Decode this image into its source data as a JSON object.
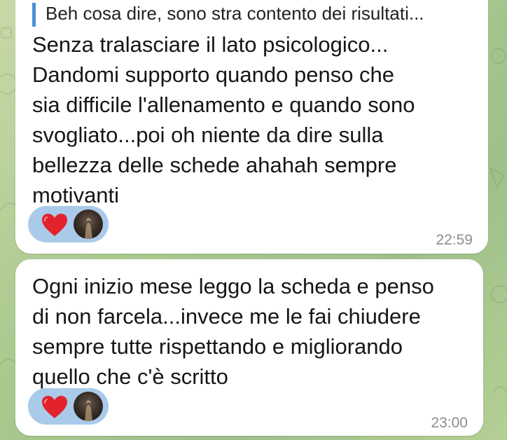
{
  "messages": [
    {
      "reply_preview": "Beh cosa dire, sono stra contento dei risultati...",
      "text": "Senza tralasciare il lato psicologico...\nDandomi supporto quando penso che\nsia difficile l'allenamento e quando sono\nsvogliato...poi oh niente da dire sulla\nbellezza delle schede ahahah sempre\nmotivanti",
      "reaction_icon": "heart-icon",
      "time": "22:59"
    },
    {
      "text": "Ogni inizio mese leggo la scheda e penso\ndi non farcela...invece me le fai chiudere\nsempre tutte rispettando e migliorando\nquello che c'è scritto",
      "reaction_icon": "heart-icon",
      "time": "23:00"
    }
  ],
  "colors": {
    "background": "#a9c98f",
    "bubble": "#ffffff",
    "reply_bar": "#4c8fd6",
    "reaction_pill": "#a9cbe9",
    "heart": "#e2232e",
    "time": "#8e8e8e"
  }
}
